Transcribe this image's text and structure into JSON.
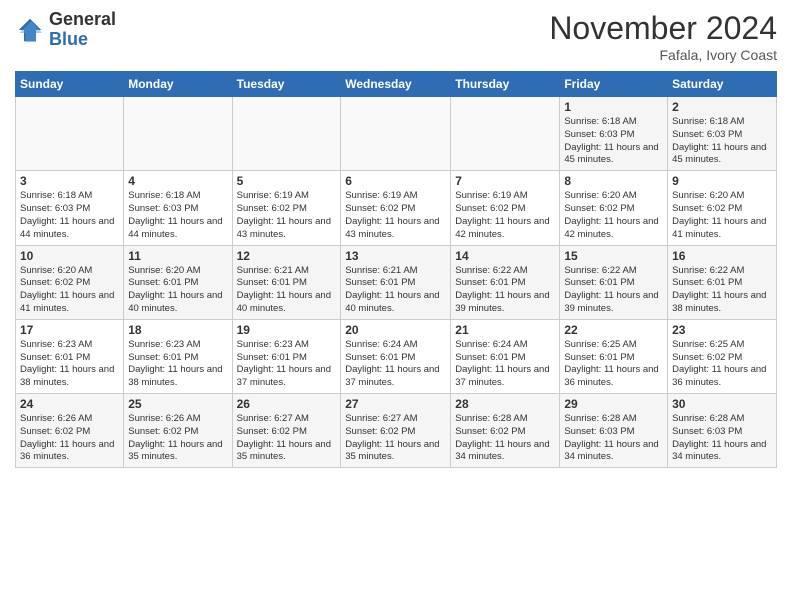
{
  "logo": {
    "general": "General",
    "blue": "Blue"
  },
  "title": "November 2024",
  "location": "Fafala, Ivory Coast",
  "days_of_week": [
    "Sunday",
    "Monday",
    "Tuesday",
    "Wednesday",
    "Thursday",
    "Friday",
    "Saturday"
  ],
  "weeks": [
    [
      {
        "day": "",
        "info": ""
      },
      {
        "day": "",
        "info": ""
      },
      {
        "day": "",
        "info": ""
      },
      {
        "day": "",
        "info": ""
      },
      {
        "day": "",
        "info": ""
      },
      {
        "day": "1",
        "info": "Sunrise: 6:18 AM\nSunset: 6:03 PM\nDaylight: 11 hours\nand 45 minutes."
      },
      {
        "day": "2",
        "info": "Sunrise: 6:18 AM\nSunset: 6:03 PM\nDaylight: 11 hours\nand 45 minutes."
      }
    ],
    [
      {
        "day": "3",
        "info": "Sunrise: 6:18 AM\nSunset: 6:03 PM\nDaylight: 11 hours\nand 44 minutes."
      },
      {
        "day": "4",
        "info": "Sunrise: 6:18 AM\nSunset: 6:03 PM\nDaylight: 11 hours\nand 44 minutes."
      },
      {
        "day": "5",
        "info": "Sunrise: 6:19 AM\nSunset: 6:02 PM\nDaylight: 11 hours\nand 43 minutes."
      },
      {
        "day": "6",
        "info": "Sunrise: 6:19 AM\nSunset: 6:02 PM\nDaylight: 11 hours\nand 43 minutes."
      },
      {
        "day": "7",
        "info": "Sunrise: 6:19 AM\nSunset: 6:02 PM\nDaylight: 11 hours\nand 42 minutes."
      },
      {
        "day": "8",
        "info": "Sunrise: 6:20 AM\nSunset: 6:02 PM\nDaylight: 11 hours\nand 42 minutes."
      },
      {
        "day": "9",
        "info": "Sunrise: 6:20 AM\nSunset: 6:02 PM\nDaylight: 11 hours\nand 41 minutes."
      }
    ],
    [
      {
        "day": "10",
        "info": "Sunrise: 6:20 AM\nSunset: 6:02 PM\nDaylight: 11 hours\nand 41 minutes."
      },
      {
        "day": "11",
        "info": "Sunrise: 6:20 AM\nSunset: 6:01 PM\nDaylight: 11 hours\nand 40 minutes."
      },
      {
        "day": "12",
        "info": "Sunrise: 6:21 AM\nSunset: 6:01 PM\nDaylight: 11 hours\nand 40 minutes."
      },
      {
        "day": "13",
        "info": "Sunrise: 6:21 AM\nSunset: 6:01 PM\nDaylight: 11 hours\nand 40 minutes."
      },
      {
        "day": "14",
        "info": "Sunrise: 6:22 AM\nSunset: 6:01 PM\nDaylight: 11 hours\nand 39 minutes."
      },
      {
        "day": "15",
        "info": "Sunrise: 6:22 AM\nSunset: 6:01 PM\nDaylight: 11 hours\nand 39 minutes."
      },
      {
        "day": "16",
        "info": "Sunrise: 6:22 AM\nSunset: 6:01 PM\nDaylight: 11 hours\nand 38 minutes."
      }
    ],
    [
      {
        "day": "17",
        "info": "Sunrise: 6:23 AM\nSunset: 6:01 PM\nDaylight: 11 hours\nand 38 minutes."
      },
      {
        "day": "18",
        "info": "Sunrise: 6:23 AM\nSunset: 6:01 PM\nDaylight: 11 hours\nand 38 minutes."
      },
      {
        "day": "19",
        "info": "Sunrise: 6:23 AM\nSunset: 6:01 PM\nDaylight: 11 hours\nand 37 minutes."
      },
      {
        "day": "20",
        "info": "Sunrise: 6:24 AM\nSunset: 6:01 PM\nDaylight: 11 hours\nand 37 minutes."
      },
      {
        "day": "21",
        "info": "Sunrise: 6:24 AM\nSunset: 6:01 PM\nDaylight: 11 hours\nand 37 minutes."
      },
      {
        "day": "22",
        "info": "Sunrise: 6:25 AM\nSunset: 6:01 PM\nDaylight: 11 hours\nand 36 minutes."
      },
      {
        "day": "23",
        "info": "Sunrise: 6:25 AM\nSunset: 6:02 PM\nDaylight: 11 hours\nand 36 minutes."
      }
    ],
    [
      {
        "day": "24",
        "info": "Sunrise: 6:26 AM\nSunset: 6:02 PM\nDaylight: 11 hours\nand 36 minutes."
      },
      {
        "day": "25",
        "info": "Sunrise: 6:26 AM\nSunset: 6:02 PM\nDaylight: 11 hours\nand 35 minutes."
      },
      {
        "day": "26",
        "info": "Sunrise: 6:27 AM\nSunset: 6:02 PM\nDaylight: 11 hours\nand 35 minutes."
      },
      {
        "day": "27",
        "info": "Sunrise: 6:27 AM\nSunset: 6:02 PM\nDaylight: 11 hours\nand 35 minutes."
      },
      {
        "day": "28",
        "info": "Sunrise: 6:28 AM\nSunset: 6:02 PM\nDaylight: 11 hours\nand 34 minutes."
      },
      {
        "day": "29",
        "info": "Sunrise: 6:28 AM\nSunset: 6:03 PM\nDaylight: 11 hours\nand 34 minutes."
      },
      {
        "day": "30",
        "info": "Sunrise: 6:28 AM\nSunset: 6:03 PM\nDaylight: 11 hours\nand 34 minutes."
      }
    ]
  ]
}
